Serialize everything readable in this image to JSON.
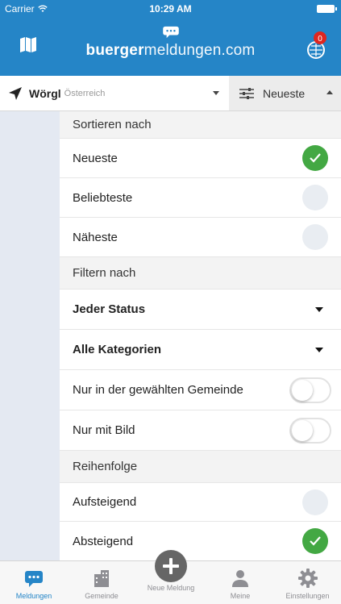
{
  "status_bar": {
    "carrier": "Carrier",
    "time": "10:29 AM"
  },
  "header": {
    "brand_bold": "buerger",
    "brand_rest": "meldungen.com",
    "notification_count": "0"
  },
  "location_bar": {
    "city": "Wörgl",
    "country": "Österreich",
    "sort_label": "Neueste"
  },
  "panel": {
    "sort_header": "Sortieren nach",
    "sort_options": [
      {
        "label": "Neueste",
        "selected": true
      },
      {
        "label": "Beliebteste",
        "selected": false
      },
      {
        "label": "Näheste",
        "selected": false
      }
    ],
    "filter_header": "Filtern nach",
    "status_filter": "Jeder Status",
    "category_filter": "Alle Kategorien",
    "toggles": [
      {
        "label": "Nur in der gewählten Gemeinde",
        "on": false
      },
      {
        "label": "Nur mit Bild",
        "on": false
      }
    ],
    "order_header": "Reihenfolge",
    "order_options": [
      {
        "label": "Aufsteigend",
        "selected": false
      },
      {
        "label": "Absteigend",
        "selected": true
      }
    ]
  },
  "tab_bar": {
    "tabs": [
      {
        "label": "Meldungen",
        "icon": "chat-bubble-icon",
        "active": true
      },
      {
        "label": "Gemeinde",
        "icon": "building-icon",
        "active": false
      },
      {
        "label": "Neue Meldung",
        "icon": "plus-circle-icon",
        "active": false
      },
      {
        "label": "Meine",
        "icon": "person-icon",
        "active": false
      },
      {
        "label": "Einstellungen",
        "icon": "gear-icon",
        "active": false
      }
    ]
  },
  "colors": {
    "brand_blue": "#2585c7",
    "selected_green": "#43a843",
    "badge_red": "#e0261f"
  }
}
